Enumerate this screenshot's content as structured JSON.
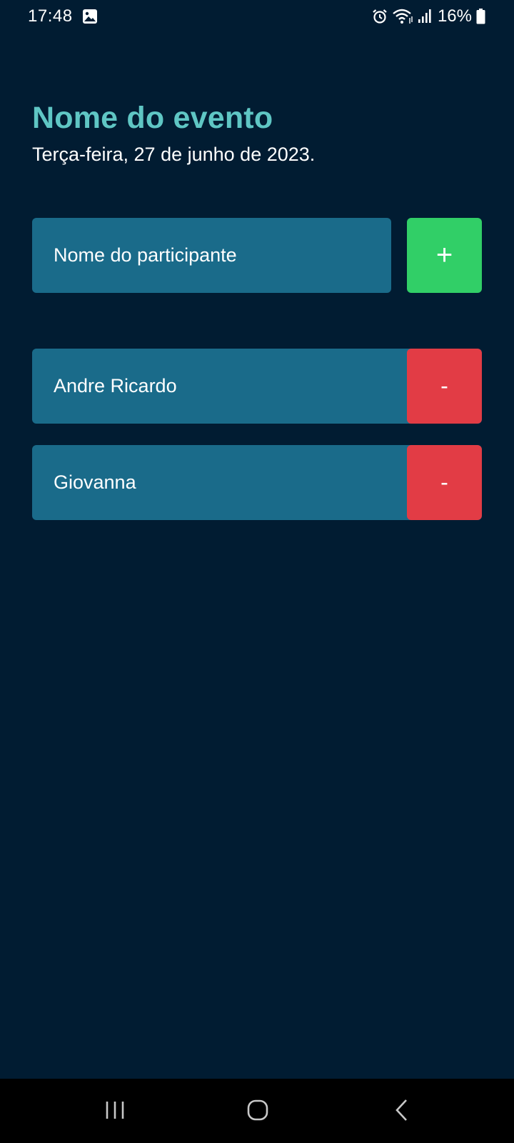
{
  "status_bar": {
    "time": "17:48",
    "battery": "16%",
    "icons": [
      "gallery-icon",
      "alarm-icon",
      "wifi-icon",
      "signal-icon",
      "battery-icon"
    ]
  },
  "header": {
    "title": "Nome do evento",
    "date": "Terça-feira, 27 de junho de 2023."
  },
  "form": {
    "placeholder": "Nome do participante",
    "add_label": "+"
  },
  "participants": [
    {
      "name": "Andre Ricardo",
      "remove_label": "-"
    },
    {
      "name": "Giovanna",
      "remove_label": "-"
    }
  ],
  "nav_bar": {
    "icons": [
      "recent-apps-icon",
      "home-icon",
      "back-icon"
    ]
  },
  "colors": {
    "background": "#011c32",
    "title": "#5fc6c4",
    "field": "#1a6b8a",
    "add": "#31cf67",
    "remove": "#e23c45"
  }
}
